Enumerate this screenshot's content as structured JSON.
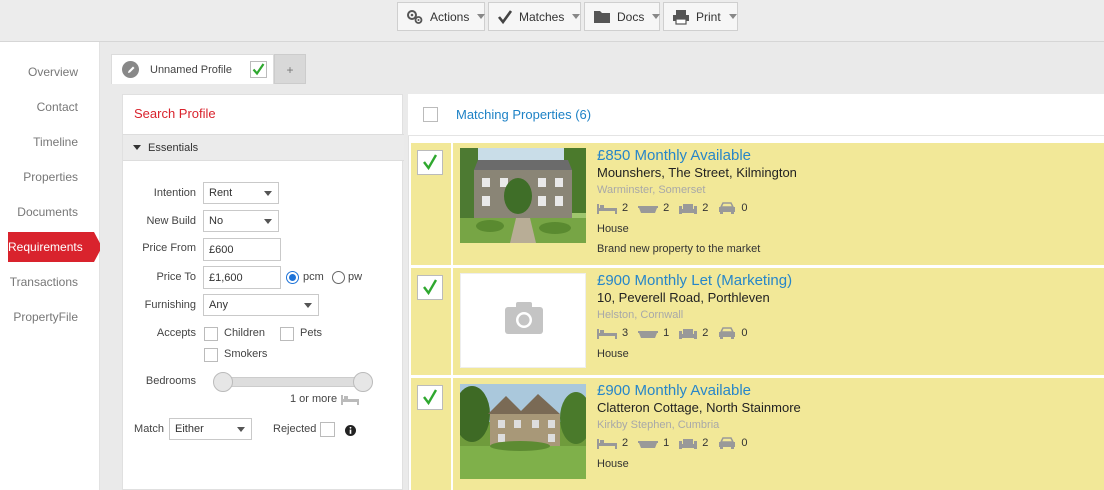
{
  "toolbar": {
    "actions_label": "Actions",
    "matches_label": "Matches",
    "docs_label": "Docs",
    "print_label": "Print"
  },
  "sidebar": {
    "items": [
      {
        "label": "Overview"
      },
      {
        "label": "Contact"
      },
      {
        "label": "Timeline"
      },
      {
        "label": "Properties"
      },
      {
        "label": "Documents"
      },
      {
        "label": "Requirements",
        "active": true
      },
      {
        "label": "Transactions"
      },
      {
        "label": "PropertyFile"
      }
    ]
  },
  "tabs": {
    "profile_label": "Unnamed Profile",
    "add_label": "+"
  },
  "search_profile": {
    "title": "Search Profile",
    "section_label": "Essentials",
    "intention_label": "Intention",
    "intention_value": "Rent",
    "new_build_label": "New Build",
    "new_build_value": "No",
    "price_from_label": "Price From",
    "price_from_value": "£600",
    "price_to_label": "Price To",
    "price_to_value": "£1,600",
    "pcm_label": "pcm",
    "pw_label": "pw",
    "furnishing_label": "Furnishing",
    "furnishing_value": "Any",
    "accepts_label": "Accepts",
    "children_label": "Children",
    "pets_label": "Pets",
    "smokers_label": "Smokers",
    "bedrooms_label": "Bedrooms",
    "bedrooms_value": "1 or more",
    "match_label": "Match",
    "match_value": "Either",
    "rejected_label": "Rejected"
  },
  "matching": {
    "title": "Matching Properties (6)",
    "properties": [
      {
        "price": "£850 Monthly Available",
        "address": "Mounshers, The Street, Kilmington",
        "location": "Warminster, Somerset",
        "beds": "2",
        "baths": "2",
        "receptions": "2",
        "parking": "0",
        "type": "House",
        "description": "Brand new property to the market"
      },
      {
        "price": "£900 Monthly Let (Marketing)",
        "address": "10, Peverell Road, Porthleven",
        "location": "Helston, Cornwall",
        "beds": "3",
        "baths": "1",
        "receptions": "2",
        "parking": "0",
        "type": "House",
        "description": ""
      },
      {
        "price": "£900 Monthly Available",
        "address": "Clatteron Cottage, North Stainmore",
        "location": "Kirkby Stephen, Cumbria",
        "beds": "2",
        "baths": "1",
        "receptions": "2",
        "parking": "0",
        "type": "House",
        "description": ""
      }
    ]
  },
  "colors": {
    "accent_red": "#d9232d",
    "link_blue": "#2786c9",
    "card_yellow": "#f2e898",
    "check_green": "#2fa82f"
  }
}
